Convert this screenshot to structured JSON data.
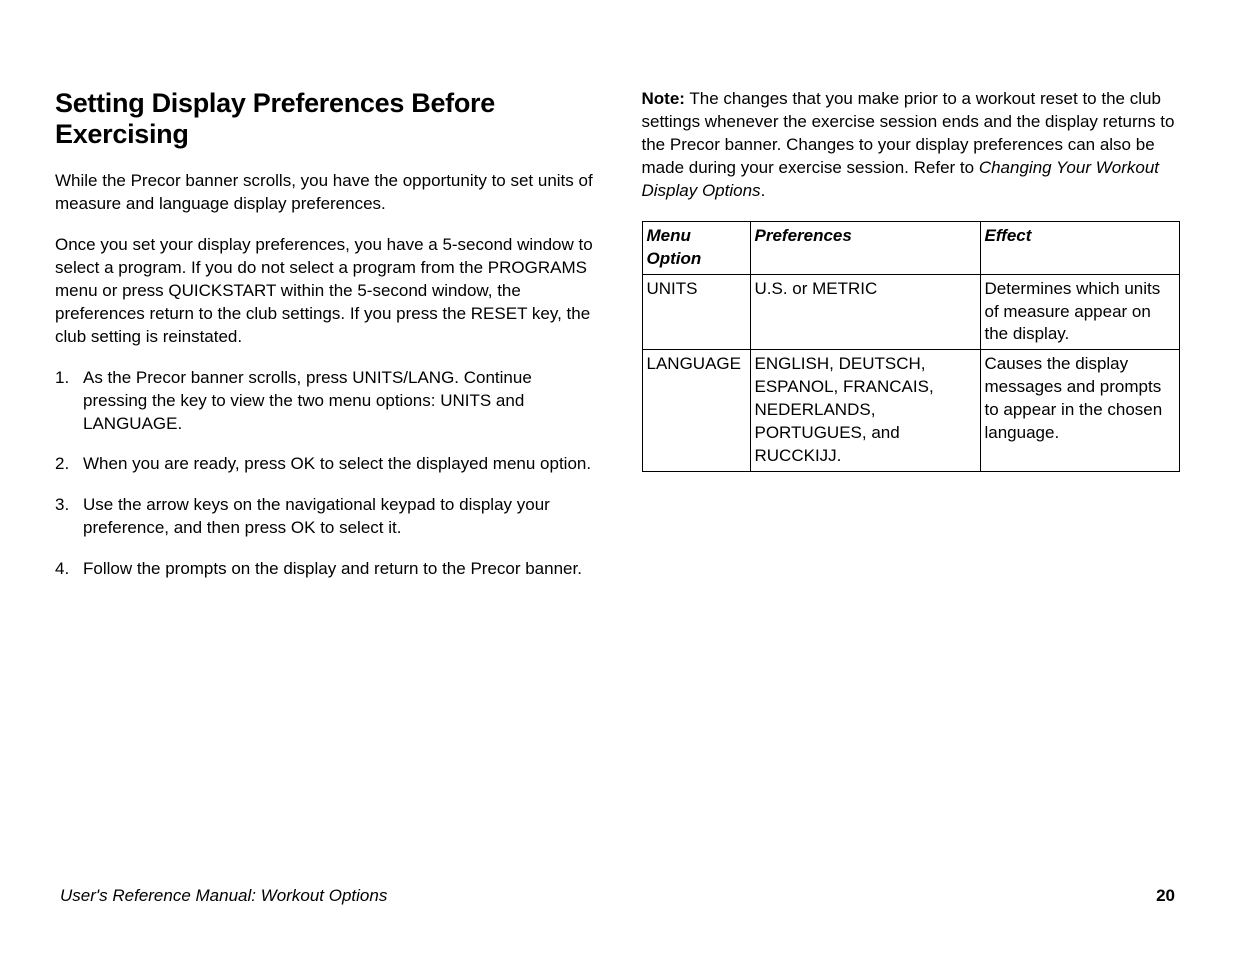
{
  "left": {
    "heading": "Setting Display Preferences Before Exercising",
    "para1": "While the Precor banner scrolls, you have the opportunity to set units of measure and language display preferences.",
    "para2": "Once you set your display preferences, you have a 5-second window to select a program. If you do not select a program from the PROGRAMS menu or press QUICKSTART within the 5-second window, the preferences return to the club settings. If you press the RESET key, the club setting is reinstated.",
    "steps": [
      "As the Precor banner scrolls, press UNITS/LANG. Continue pressing the key to view the two menu options: UNITS and LANGUAGE.",
      "When you are ready, press OK to select the displayed menu option.",
      "Use the arrow keys on the navigational keypad to display your preference, and then press OK to select it.",
      "Follow the prompts on the display and return to the Precor banner."
    ]
  },
  "right": {
    "note_label": "Note:",
    "note_text": " The changes that you make prior to a workout reset to the club settings whenever the exercise session ends and the display returns to the Precor banner. Changes to your display preferences can also be made during your exercise session. Refer to ",
    "note_ref": "Changing Your Workout Display Options",
    "note_period": ".",
    "table": {
      "headers": [
        "Menu Option",
        "Preferences",
        "Effect"
      ],
      "rows": [
        {
          "menu": "UNITS",
          "pref": "U.S. or METRIC",
          "effect": "Determines which units of measure appear on the display."
        },
        {
          "menu": "LANGUAGE",
          "pref": "ENGLISH, DEUTSCH, ESPANOL, FRANCAIS, NEDERLANDS, PORTUGUES, and RUCCKIJJ.",
          "effect": "Causes the display messages and prompts to appear in the chosen language."
        }
      ]
    }
  },
  "footer": {
    "left": "User's Reference Manual: Workout Options",
    "right": "20"
  }
}
